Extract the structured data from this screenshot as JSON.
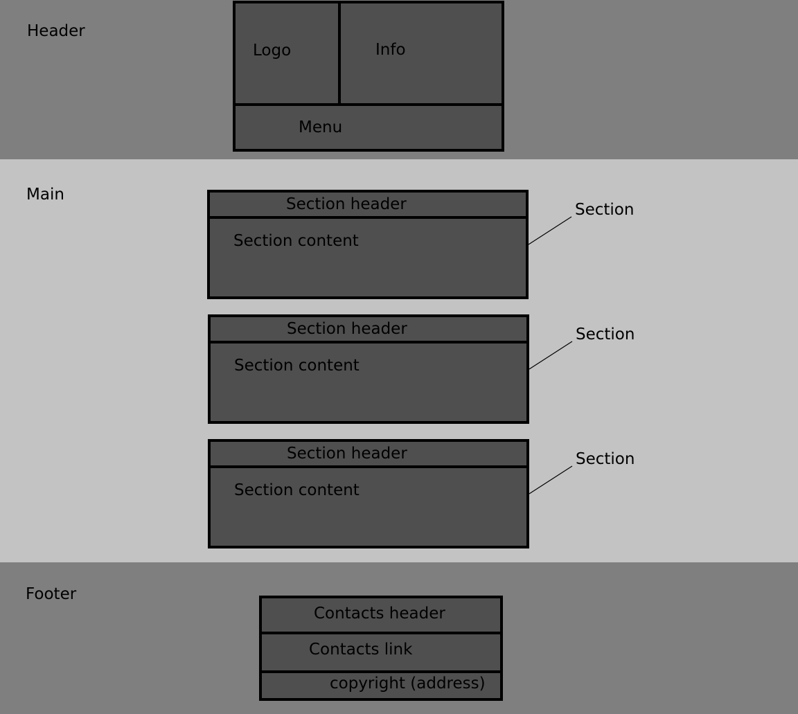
{
  "header": {
    "label": "Header",
    "logo": "Logo",
    "info": "Info",
    "menu": "Menu"
  },
  "main": {
    "label": "Main",
    "sections": [
      {
        "header": "Section header",
        "content": "Section content",
        "callout": "Section"
      },
      {
        "header": "Section header",
        "content": "Section content",
        "callout": "Section"
      },
      {
        "header": "Section header",
        "content": "Section content",
        "callout": "Section"
      }
    ]
  },
  "footer": {
    "label": "Footer",
    "contacts_header": "Contacts header",
    "contacts_link": "Contacts link",
    "copyright": "copyright (address)"
  }
}
